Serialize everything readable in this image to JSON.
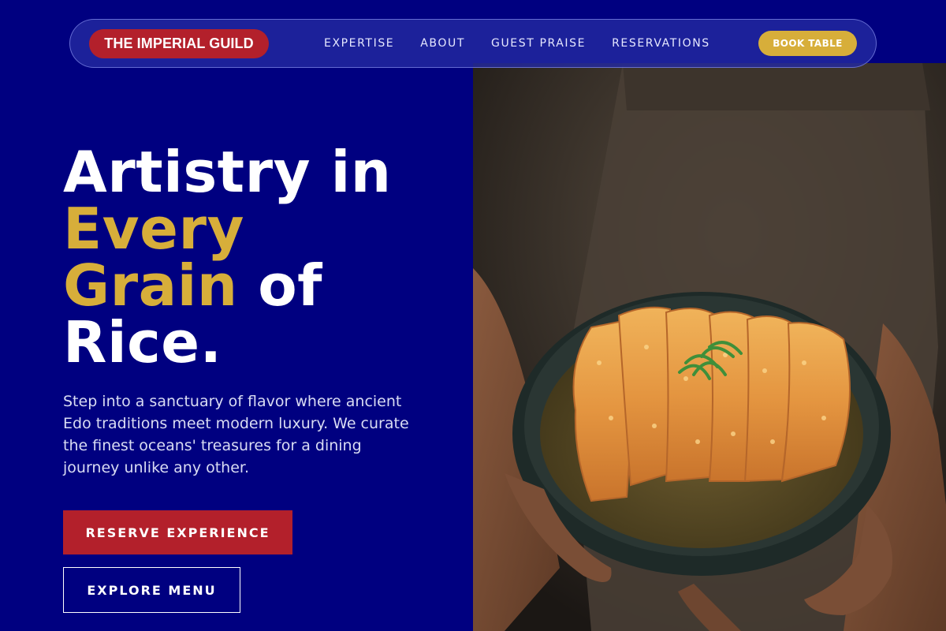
{
  "brand": {
    "name": "THE IMPERIAL GUILD"
  },
  "nav": {
    "links": [
      {
        "label": "EXPERTISE"
      },
      {
        "label": "ABOUT"
      },
      {
        "label": "GUEST PRAISE"
      },
      {
        "label": "RESERVATIONS"
      }
    ],
    "cta_label": "BOOK TABLE"
  },
  "hero": {
    "headline": {
      "line1": "Artistry in",
      "accent1": "Every",
      "accent2": "Grain",
      "after_accent": " of",
      "line4": "Rice."
    },
    "description": "Step into a sanctuary of flavor where ancient Edo traditions meet modern luxury. We curate the finest oceans' treasures for a dining journey unlike any other.",
    "primary_button": "RESERVE EXPERIENCE",
    "secondary_button": "EXPLORE MENU",
    "image_subject": "chef-holding-katsu-curry-bowl"
  },
  "colors": {
    "background": "#000080",
    "accent_gold": "#d7ae3a",
    "accent_red": "#b3202b",
    "text": "#ffffff"
  }
}
